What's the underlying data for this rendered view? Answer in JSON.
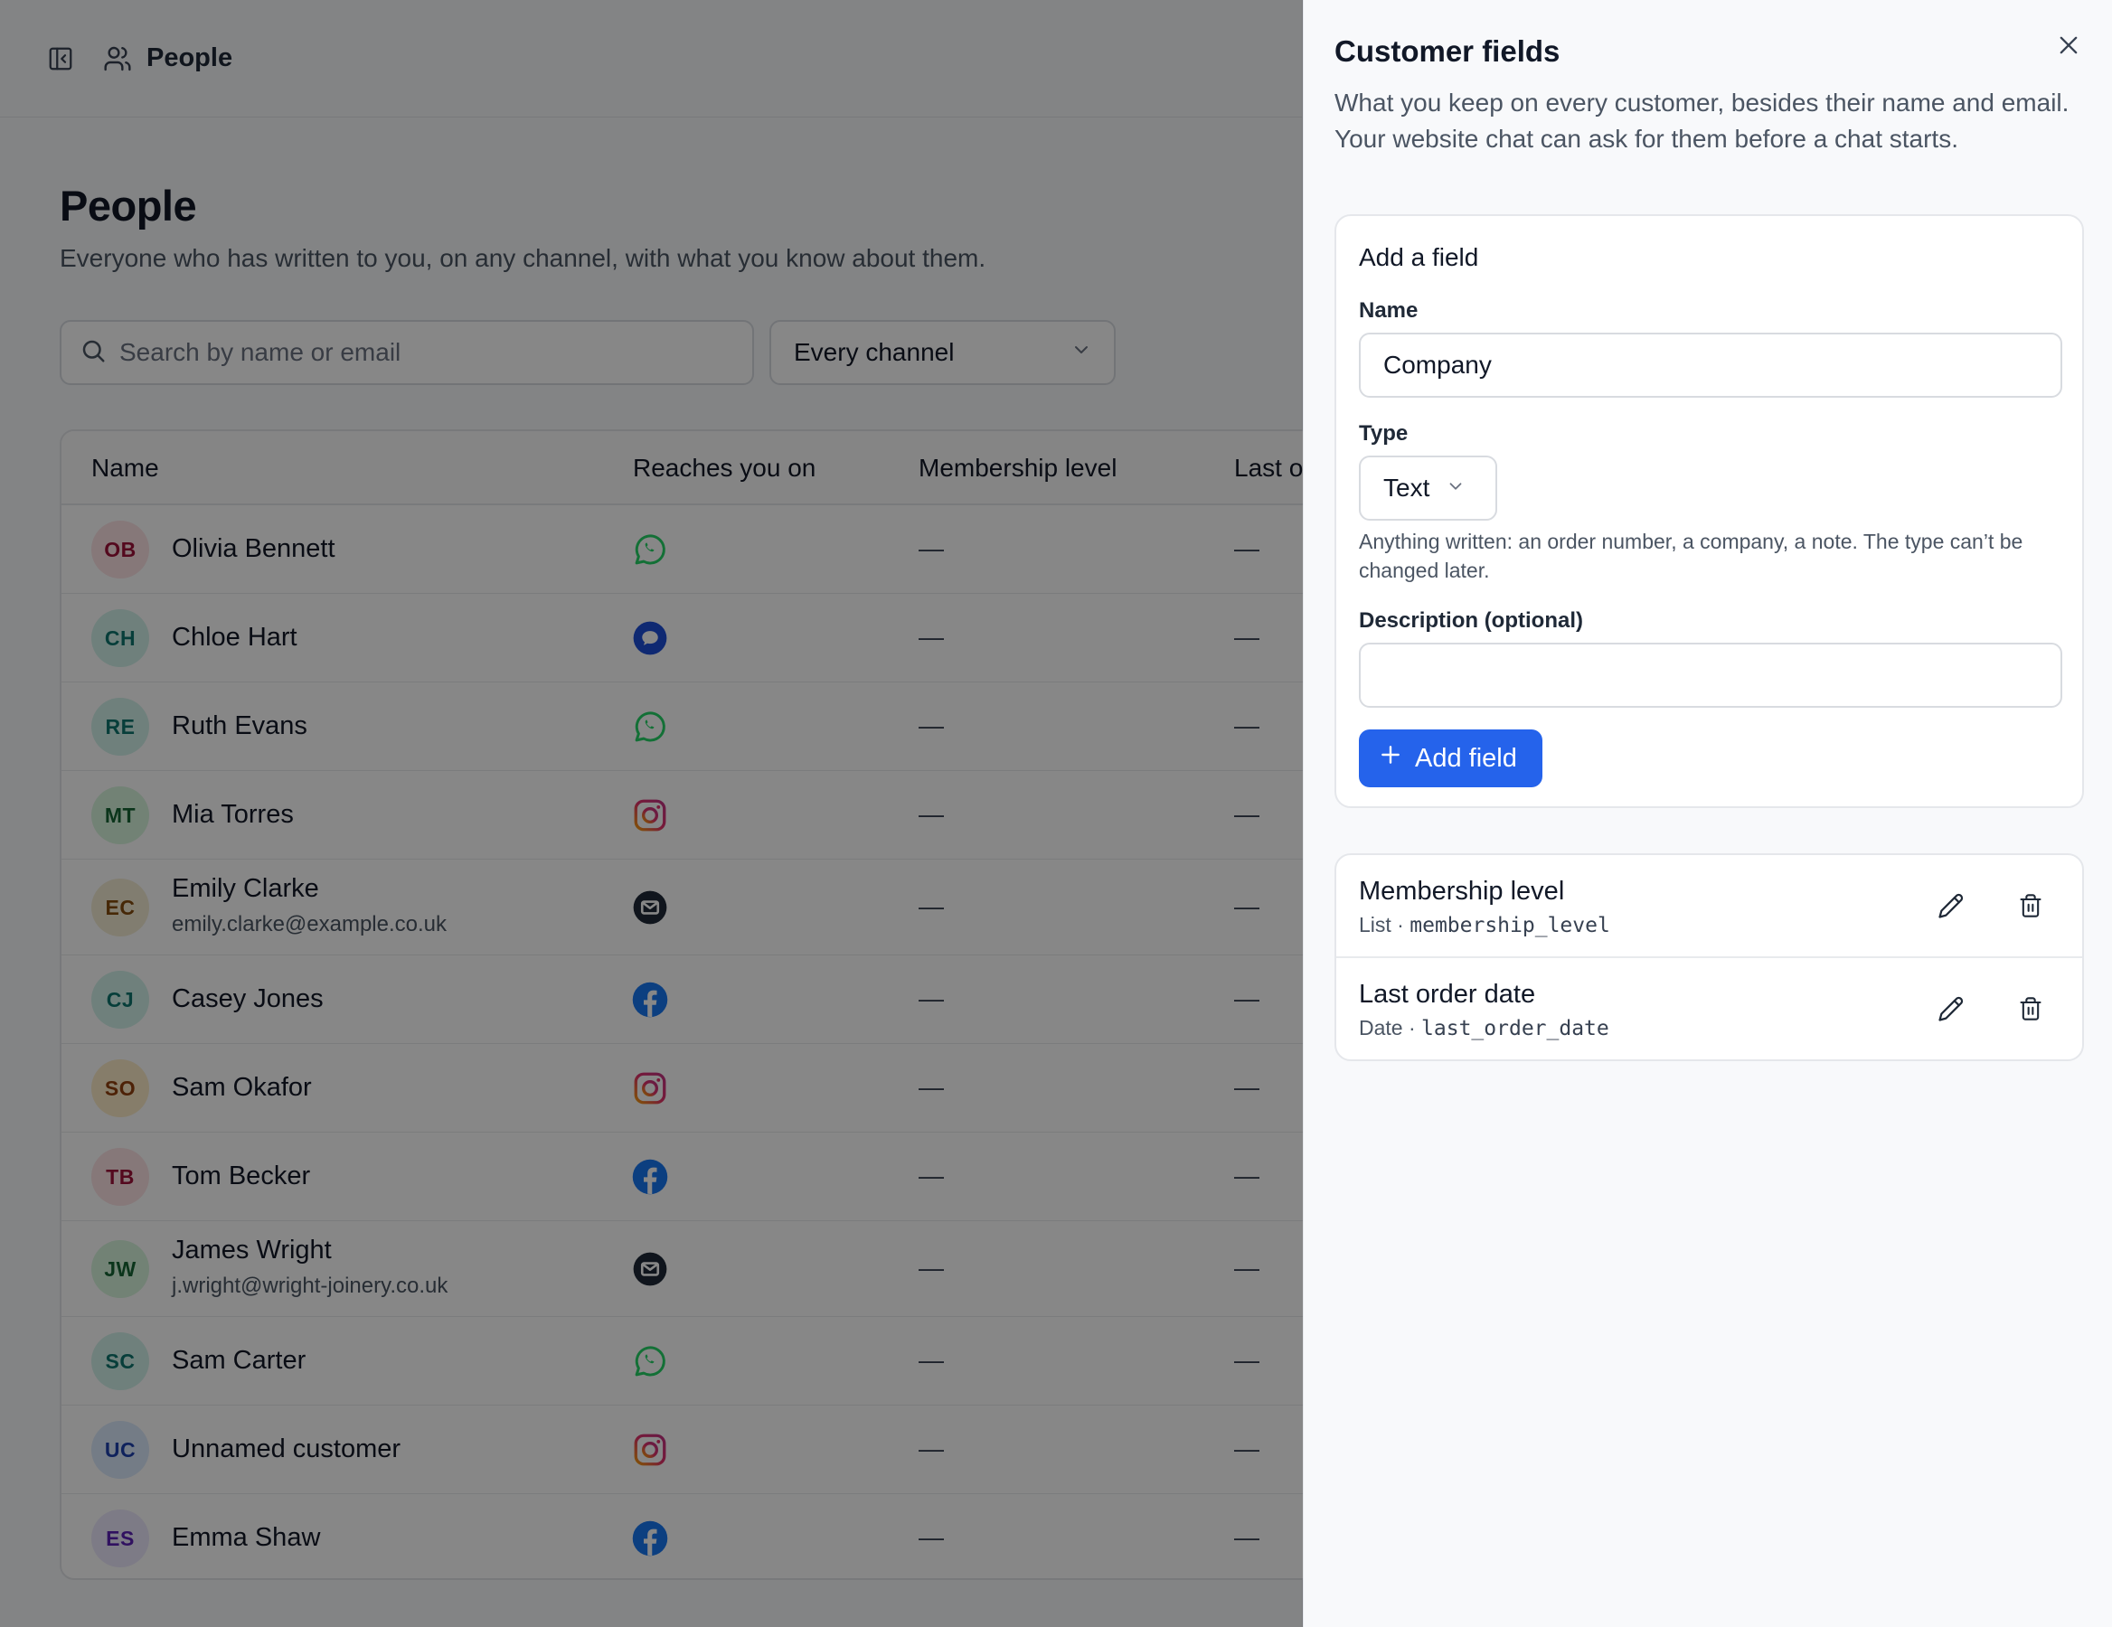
{
  "topbar": {
    "breadcrumb": "People"
  },
  "page": {
    "title": "People",
    "subtitle": "Everyone who has written to you, on any channel, with what you know about them."
  },
  "search": {
    "placeholder": "Search by name or email",
    "value": ""
  },
  "channel_filter": {
    "selected": "Every channel"
  },
  "table": {
    "columns": [
      "Name",
      "Reaches you on",
      "Membership level",
      "Last o"
    ],
    "rows": [
      {
        "initials": "OB",
        "name": "Olivia Bennett",
        "email": "",
        "channel": "whatsapp",
        "membership": "—",
        "last_order": "—",
        "avatar_bg": "#fde2e4",
        "avatar_fg": "#9f1239"
      },
      {
        "initials": "CH",
        "name": "Chloe Hart",
        "email": "",
        "channel": "chat",
        "membership": "—",
        "last_order": "—",
        "avatar_bg": "#d1f2ea",
        "avatar_fg": "#0f766e"
      },
      {
        "initials": "RE",
        "name": "Ruth Evans",
        "email": "",
        "channel": "whatsapp",
        "membership": "—",
        "last_order": "—",
        "avatar_bg": "#d1f2ea",
        "avatar_fg": "#0f766e"
      },
      {
        "initials": "MT",
        "name": "Mia Torres",
        "email": "",
        "channel": "instagram",
        "membership": "—",
        "last_order": "—",
        "avatar_bg": "#d7f5dd",
        "avatar_fg": "#166534"
      },
      {
        "initials": "EC",
        "name": "Emily Clarke",
        "email": "emily.clarke@example.co.uk",
        "channel": "email",
        "membership": "—",
        "last_order": "—",
        "avatar_bg": "#f3ecd3",
        "avatar_fg": "#854d0e"
      },
      {
        "initials": "CJ",
        "name": "Casey Jones",
        "email": "",
        "channel": "facebook",
        "membership": "—",
        "last_order": "—",
        "avatar_bg": "#d1f2ea",
        "avatar_fg": "#0f766e"
      },
      {
        "initials": "SO",
        "name": "Sam Okafor",
        "email": "",
        "channel": "instagram",
        "membership": "—",
        "last_order": "—",
        "avatar_bg": "#fdecc8",
        "avatar_fg": "#92400e"
      },
      {
        "initials": "TB",
        "name": "Tom Becker",
        "email": "",
        "channel": "facebook",
        "membership": "—",
        "last_order": "—",
        "avatar_bg": "#fde2e4",
        "avatar_fg": "#9f1239"
      },
      {
        "initials": "JW",
        "name": "James Wright",
        "email": "j.wright@wright-joinery.co.uk",
        "channel": "email",
        "membership": "—",
        "last_order": "—",
        "avatar_bg": "#d7f5dd",
        "avatar_fg": "#166534"
      },
      {
        "initials": "SC",
        "name": "Sam Carter",
        "email": "",
        "channel": "whatsapp",
        "membership": "—",
        "last_order": "—",
        "avatar_bg": "#d1f2ea",
        "avatar_fg": "#0f766e"
      },
      {
        "initials": "UC",
        "name": "Unnamed customer",
        "email": "",
        "channel": "instagram",
        "membership": "—",
        "last_order": "—",
        "avatar_bg": "#dbeafe",
        "avatar_fg": "#1e40af"
      },
      {
        "initials": "ES",
        "name": "Emma Shaw",
        "email": "",
        "channel": "facebook",
        "membership": "—",
        "last_order": "—",
        "avatar_bg": "#ede9fe",
        "avatar_fg": "#5b21b6"
      }
    ]
  },
  "panel": {
    "title": "Customer fields",
    "subtitle": "What you keep on every customer, besides their name and email. Your website chat can ask for them before a chat starts.",
    "add_field": {
      "title": "Add a field",
      "name_label": "Name",
      "name_value": "Company",
      "type_label": "Type",
      "type_value": "Text",
      "type_hint": "Anything written: an order number, a company, a note. The type can’t be changed later.",
      "description_label": "Description (optional)",
      "description_value": "",
      "button_label": "Add field"
    },
    "fields": [
      {
        "name": "Membership level",
        "type": "List",
        "key": "membership_level"
      },
      {
        "name": "Last order date",
        "type": "Date",
        "key": "last_order_date"
      }
    ]
  },
  "colors": {
    "accent": "#2563eb",
    "whatsapp": "#25d366",
    "facebook": "#1877f2",
    "chat": "#1d4ed8",
    "email": "#1f2937"
  }
}
